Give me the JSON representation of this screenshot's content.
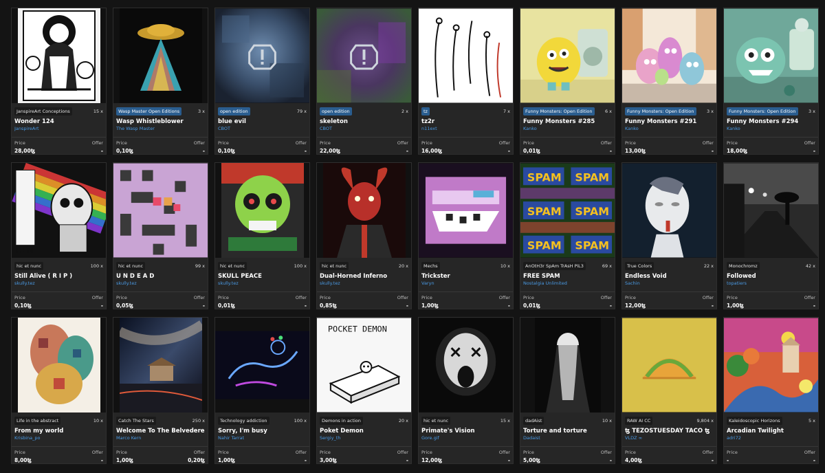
{
  "labels": {
    "price": "Price",
    "offer": "Offer"
  },
  "cards": [
    {
      "collection": "JanspireArt Conceptions",
      "collection_style": "dark",
      "editions": "15 x",
      "title": "Wonder 124",
      "artist": "JanspireArt",
      "price": "28,00ꜩ",
      "offer": "-",
      "art": "bw-poster"
    },
    {
      "collection": "Wasp Master Open Editions",
      "collection_style": "blue",
      "editions": "3 x",
      "title": "Wasp Whistleblower",
      "artist": "The Wasp Master",
      "price": "0,10ꜩ",
      "offer": "-",
      "art": "ufo-beam"
    },
    {
      "collection": "open edition",
      "collection_style": "blue",
      "editions": "79 x",
      "title": "blue evil",
      "artist": "CBOT",
      "price": "0,10ꜩ",
      "offer": "-",
      "art": "blurred-blue"
    },
    {
      "collection": "open edition",
      "collection_style": "blue",
      "editions": "2 x",
      "title": "skeleton",
      "artist": "CBOT",
      "price": "22,00ꜩ",
      "offer": "-",
      "art": "blurred-purple"
    },
    {
      "collection": "tz",
      "collection_style": "blue",
      "editions": "7 x",
      "title": "tz2r",
      "artist": "n11ext",
      "price": "16,00ꜩ",
      "offer": "-",
      "art": "line-drawing"
    },
    {
      "collection": "Funny Monsters: Open Edition",
      "collection_style": "blue",
      "editions": "6 x",
      "title": "Funny Monsters #285",
      "artist": "Kanko",
      "price": "0,01ꜩ",
      "offer": "-",
      "art": "yellow-monster"
    },
    {
      "collection": "Funny Monsters: Open Edition",
      "collection_style": "blue",
      "editions": "3 x",
      "title": "Funny Monsters #291",
      "artist": "Kanko",
      "price": "13,00ꜩ",
      "offer": "-",
      "art": "pink-monsters"
    },
    {
      "collection": "Funny Monsters: Open Edition",
      "collection_style": "blue",
      "editions": "3 x",
      "title": "Funny Monsters #294",
      "artist": "Kanko",
      "price": "18,00ꜩ",
      "offer": "-",
      "art": "teal-monster"
    },
    {
      "collection": "hic et nunc",
      "collection_style": "dark",
      "editions": "100 x",
      "title": "Still Alive ( R I P )",
      "artist": "skully.tez",
      "price": "0,10ꜩ",
      "offer": "-",
      "art": "rainbow-skull"
    },
    {
      "collection": "hic et nunc",
      "collection_style": "dark",
      "editions": "99 x",
      "title": "U N D E A D",
      "artist": "skully.tez",
      "price": "0,05ꜩ",
      "offer": "-",
      "art": "pixel-pink"
    },
    {
      "collection": "hic et nunc",
      "collection_style": "dark",
      "editions": "100 x",
      "title": "SKULL PEACE",
      "artist": "skully.tez",
      "price": "0,01ꜩ",
      "offer": "-",
      "art": "green-skull"
    },
    {
      "collection": "hic et nunc",
      "collection_style": "dark",
      "editions": "20 x",
      "title": "Dual-Horned Inferno",
      "artist": "skully.tez",
      "price": "0,85ꜩ",
      "offer": "-",
      "art": "red-devil"
    },
    {
      "collection": "Mechs",
      "collection_style": "dark",
      "editions": "10 x",
      "title": "Trickster",
      "artist": "Varyn",
      "price": "1,00ꜩ",
      "offer": "-",
      "art": "purple-glitch"
    },
    {
      "collection": "AnOtH3r SpAm TrAsH PiL3",
      "collection_style": "dark",
      "editions": "69 x",
      "title": "FREE SPAM",
      "artist": "Nostalgia Unlimited",
      "price": "0,01ꜩ",
      "offer": "-",
      "art": "spam"
    },
    {
      "collection": "True Colors",
      "collection_style": "dark",
      "editions": "22 x",
      "title": "Endless Void",
      "artist": "Sachin",
      "price": "12,00ꜩ",
      "offer": "-",
      "art": "mannequin"
    },
    {
      "collection": "Monochromz",
      "collection_style": "dark",
      "editions": "42 x",
      "title": "Followed",
      "artist": "topatiers",
      "price": "1,00ꜩ",
      "offer": "-",
      "art": "bw-street"
    },
    {
      "collection": "Life in the abstract",
      "collection_style": "dark",
      "editions": "10 x",
      "title": "From my world",
      "artist": "Krisbina_po",
      "price": "8,00ꜩ",
      "offer": "-",
      "art": "abstract-faces"
    },
    {
      "collection": "Catch The Stars",
      "collection_style": "dark",
      "editions": "250 x",
      "title": "Welcome To The Belvedere",
      "artist": "Marco Kern",
      "price": "1,00ꜩ",
      "offer": "0,20ꜩ",
      "art": "milky-way"
    },
    {
      "collection": "Technology addiction",
      "collection_style": "dark",
      "editions": "100 x",
      "title": "Sorry, I'm busy",
      "artist": "Nahir Tarrat",
      "price": "1,00ꜩ",
      "offer": "-",
      "art": "neon-figure"
    },
    {
      "collection": "Demons in action",
      "collection_style": "dark",
      "editions": "20 x",
      "title": "Poket Demon",
      "artist": "Sergiy_th",
      "price": "3,00ꜩ",
      "offer": "-",
      "art": "pocket-demon"
    },
    {
      "collection": "hic et nunc",
      "collection_style": "dark",
      "editions": "15 x",
      "title": "Primate's Vision",
      "artist": "Gore.gif",
      "price": "12,00ꜩ",
      "offer": "-",
      "art": "screaming-skull"
    },
    {
      "collection": "dadAist",
      "collection_style": "dark",
      "editions": "10 x",
      "title": "Torture and torture",
      "artist": "Dadaist",
      "price": "5,00ꜩ",
      "offer": "-",
      "art": "ghost"
    },
    {
      "collection": "RAW AI CC",
      "collection_style": "dark",
      "editions": "9,804 x",
      "title": "ꜩ TEZOSTUESDAY TACO ꜩ",
      "artist": "VLDZ ∞",
      "price": "4,00ꜩ",
      "offer": "-",
      "art": "taco"
    },
    {
      "collection": "Kaleidoscopic Horizons",
      "collection_style": "dark",
      "editions": "5 x",
      "title": "Arcadian Twilight",
      "artist": "adri72",
      "price": "-",
      "offer": "-",
      "art": "arcadian"
    }
  ]
}
